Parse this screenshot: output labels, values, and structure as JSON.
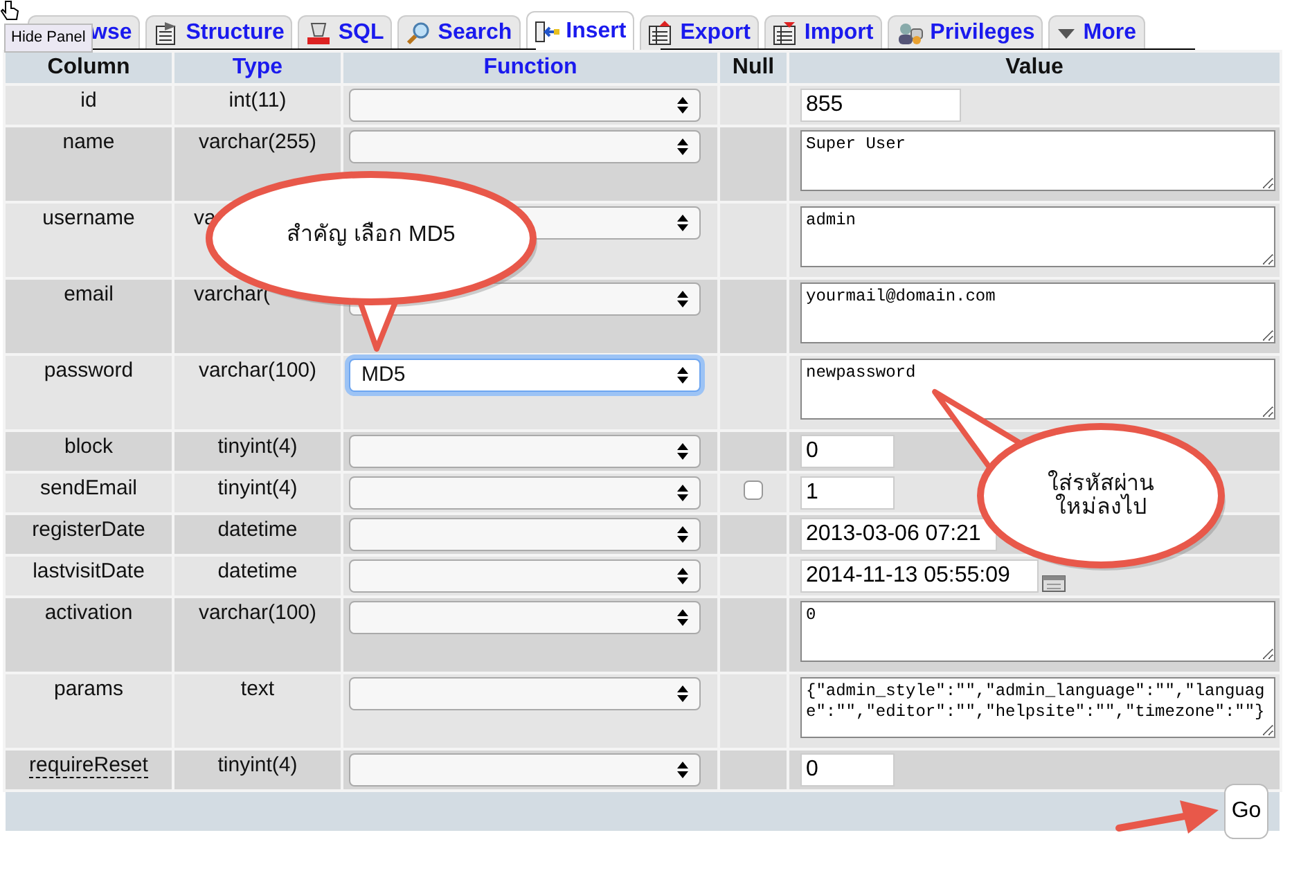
{
  "tooltip": "Hide Panel",
  "tabs": [
    {
      "label": "wse",
      "selected": false
    },
    {
      "label": "Structure",
      "selected": false
    },
    {
      "label": "SQL",
      "selected": false
    },
    {
      "label": "Search",
      "selected": false
    },
    {
      "label": "Insert",
      "selected": true
    },
    {
      "label": "Export",
      "selected": false
    },
    {
      "label": "Import",
      "selected": false
    },
    {
      "label": "Privileges",
      "selected": false
    },
    {
      "label": "More",
      "selected": false
    }
  ],
  "columns": [
    {
      "label": "Column",
      "link": false
    },
    {
      "label": "Type",
      "link": true
    },
    {
      "label": "Function",
      "link": true
    },
    {
      "label": "Null",
      "link": false
    },
    {
      "label": "Value",
      "link": false
    }
  ],
  "rows": [
    {
      "column": "id",
      "type": "int(11)",
      "type_cut": false,
      "function": "",
      "focused": false,
      "commented": false,
      "kind": "input-wide",
      "value": "855"
    },
    {
      "column": "name",
      "type": "varchar(255)",
      "type_cut": false,
      "function": "",
      "focused": false,
      "commented": false,
      "kind": "textarea",
      "value": "Super User"
    },
    {
      "column": "username",
      "type": "va",
      "type_cut": true,
      "function": "",
      "focused": false,
      "commented": false,
      "kind": "textarea",
      "value": "admin"
    },
    {
      "column": "email",
      "type": "varchar(",
      "type_cut": true,
      "function": "",
      "focused": false,
      "commented": false,
      "kind": "textarea",
      "value": "yourmail@domain.com"
    },
    {
      "column": "password",
      "type": "varchar(100)",
      "type_cut": false,
      "function": "MD5",
      "focused": true,
      "commented": false,
      "kind": "textarea",
      "value": "newpassword"
    },
    {
      "column": "block",
      "type": "tinyint(4)",
      "type_cut": false,
      "function": "",
      "focused": false,
      "commented": false,
      "kind": "input-narrow",
      "value": "0"
    },
    {
      "column": "sendEmail",
      "type": "tinyint(4)",
      "type_cut": false,
      "function": "",
      "focused": false,
      "commented": false,
      "null_checked": false,
      "kind": "input-narrow",
      "value": "1"
    },
    {
      "column": "registerDate",
      "type": "datetime",
      "type_cut": false,
      "function": "",
      "focused": false,
      "commented": false,
      "kind": "input-date",
      "value": "2013-03-06 07:21"
    },
    {
      "column": "lastvisitDate",
      "type": "datetime",
      "type_cut": false,
      "function": "",
      "focused": false,
      "commented": false,
      "kind": "input-date-calendar",
      "value": "2014-11-13 05:55:09"
    },
    {
      "column": "activation",
      "type": "varchar(100)",
      "type_cut": false,
      "function": "",
      "focused": false,
      "commented": false,
      "kind": "textarea",
      "value": "0"
    },
    {
      "column": "params",
      "type": "text",
      "type_cut": false,
      "function": "",
      "focused": false,
      "commented": false,
      "kind": "textarea",
      "value": "{\"admin_style\":\"\",\"admin_language\":\"\",\"language\":\"\",\"editor\":\"\",\"helpsite\":\"\",\"timezone\":\"\"}"
    },
    {
      "column": "requireReset",
      "type": "tinyint(4)",
      "type_cut": false,
      "function": "",
      "focused": false,
      "commented": true,
      "kind": "input-narrow",
      "value": "0"
    }
  ],
  "go_button": "Go",
  "callouts": [
    {
      "text": "สำคัญ เลือก  MD5"
    },
    {
      "text": "ใส่รหัสผ่าน\nใหม่ลงไป"
    }
  ]
}
